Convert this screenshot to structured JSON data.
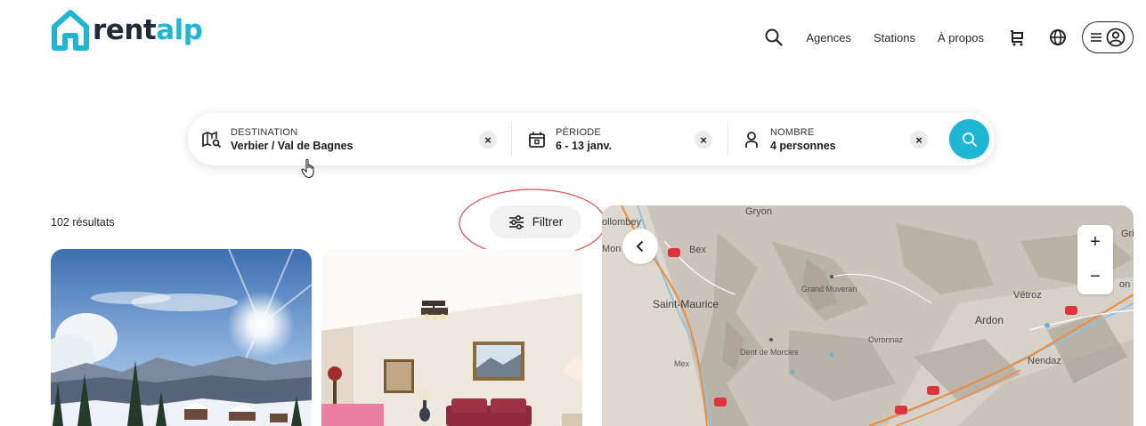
{
  "brand": {
    "part1": "rent",
    "part2": "alp",
    "icon": "house-logo-icon",
    "accent": "#1fb6d3"
  },
  "nav": {
    "search_icon": "search-icon",
    "links": [
      "Agences",
      "Stations",
      "À propos"
    ],
    "cart_icon": "cart-icon",
    "globe_icon": "globe-icon",
    "menu_icon": "hamburger-icon",
    "account_icon": "user-circle-icon"
  },
  "search": {
    "destination": {
      "label": "DESTINATION",
      "value": "Verbier / Val de Bagnes",
      "icon": "map-search-icon"
    },
    "period": {
      "label": "PÉRIODE",
      "value": "6 - 13 janv.",
      "icon": "calendar-icon"
    },
    "guests": {
      "label": "NOMBRE",
      "value": "4 personnes",
      "icon": "person-icon"
    },
    "clear_glyph": "×",
    "submit_icon": "search-icon"
  },
  "results": {
    "count_text": "102 résultats"
  },
  "filter": {
    "label": "Filtrer",
    "icon": "sliders-icon"
  },
  "map": {
    "places": [
      "Gryon",
      "ollombey",
      "Mon",
      "Bex",
      "Saint-Maurice",
      "Grand Muveran",
      "Vétroz",
      "Gri",
      "on",
      "Ardon",
      "Ovronnaz",
      "Dent de Morcles",
      "Mex",
      "Nendaz"
    ],
    "back_icon": "chevron-left-icon",
    "zoom_in": "+",
    "zoom_out": "−"
  }
}
